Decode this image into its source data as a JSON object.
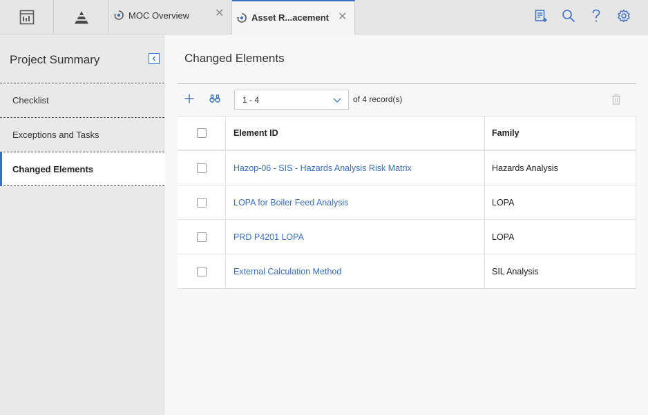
{
  "topbar": {
    "tabs": [
      {
        "label": "MOC Overview",
        "icon": "sync-icon",
        "close": "✕"
      },
      {
        "label": "Asset R...acement",
        "icon": "sync-icon",
        "close": "✕"
      }
    ],
    "icons": [
      "dashboard-icon",
      "pyramid-icon",
      "new-record-icon",
      "search-icon",
      "help-icon",
      "settings-icon"
    ]
  },
  "sidebar": {
    "title": "Project Summary",
    "items": [
      {
        "label": "Checklist"
      },
      {
        "label": "Exceptions and Tasks"
      },
      {
        "label": "Changed Elements",
        "active": true
      }
    ]
  },
  "main": {
    "title": "Changed Elements",
    "pager": {
      "selected": "1 - 4",
      "of": "of",
      "count": "4",
      "suffix": "record(s)"
    },
    "table": {
      "columns": [
        "Element ID",
        "Family"
      ],
      "rows": [
        {
          "element_id": "Hazop-06 - SIS - Hazards Analysis Risk Matrix",
          "family": "Hazards Analysis"
        },
        {
          "element_id": "LOPA for Boiler Feed Analysis",
          "family": "LOPA"
        },
        {
          "element_id": "PRD P4201 LOPA",
          "family": "LOPA"
        },
        {
          "element_id": "External Calculation Method",
          "family": "SIL Analysis"
        }
      ]
    }
  },
  "colors": {
    "accent": "#3a6fc4",
    "link": "#3a6fc4",
    "topbar_bg": "#e6e6e6",
    "sidebar_bg": "#e9e9e9"
  }
}
